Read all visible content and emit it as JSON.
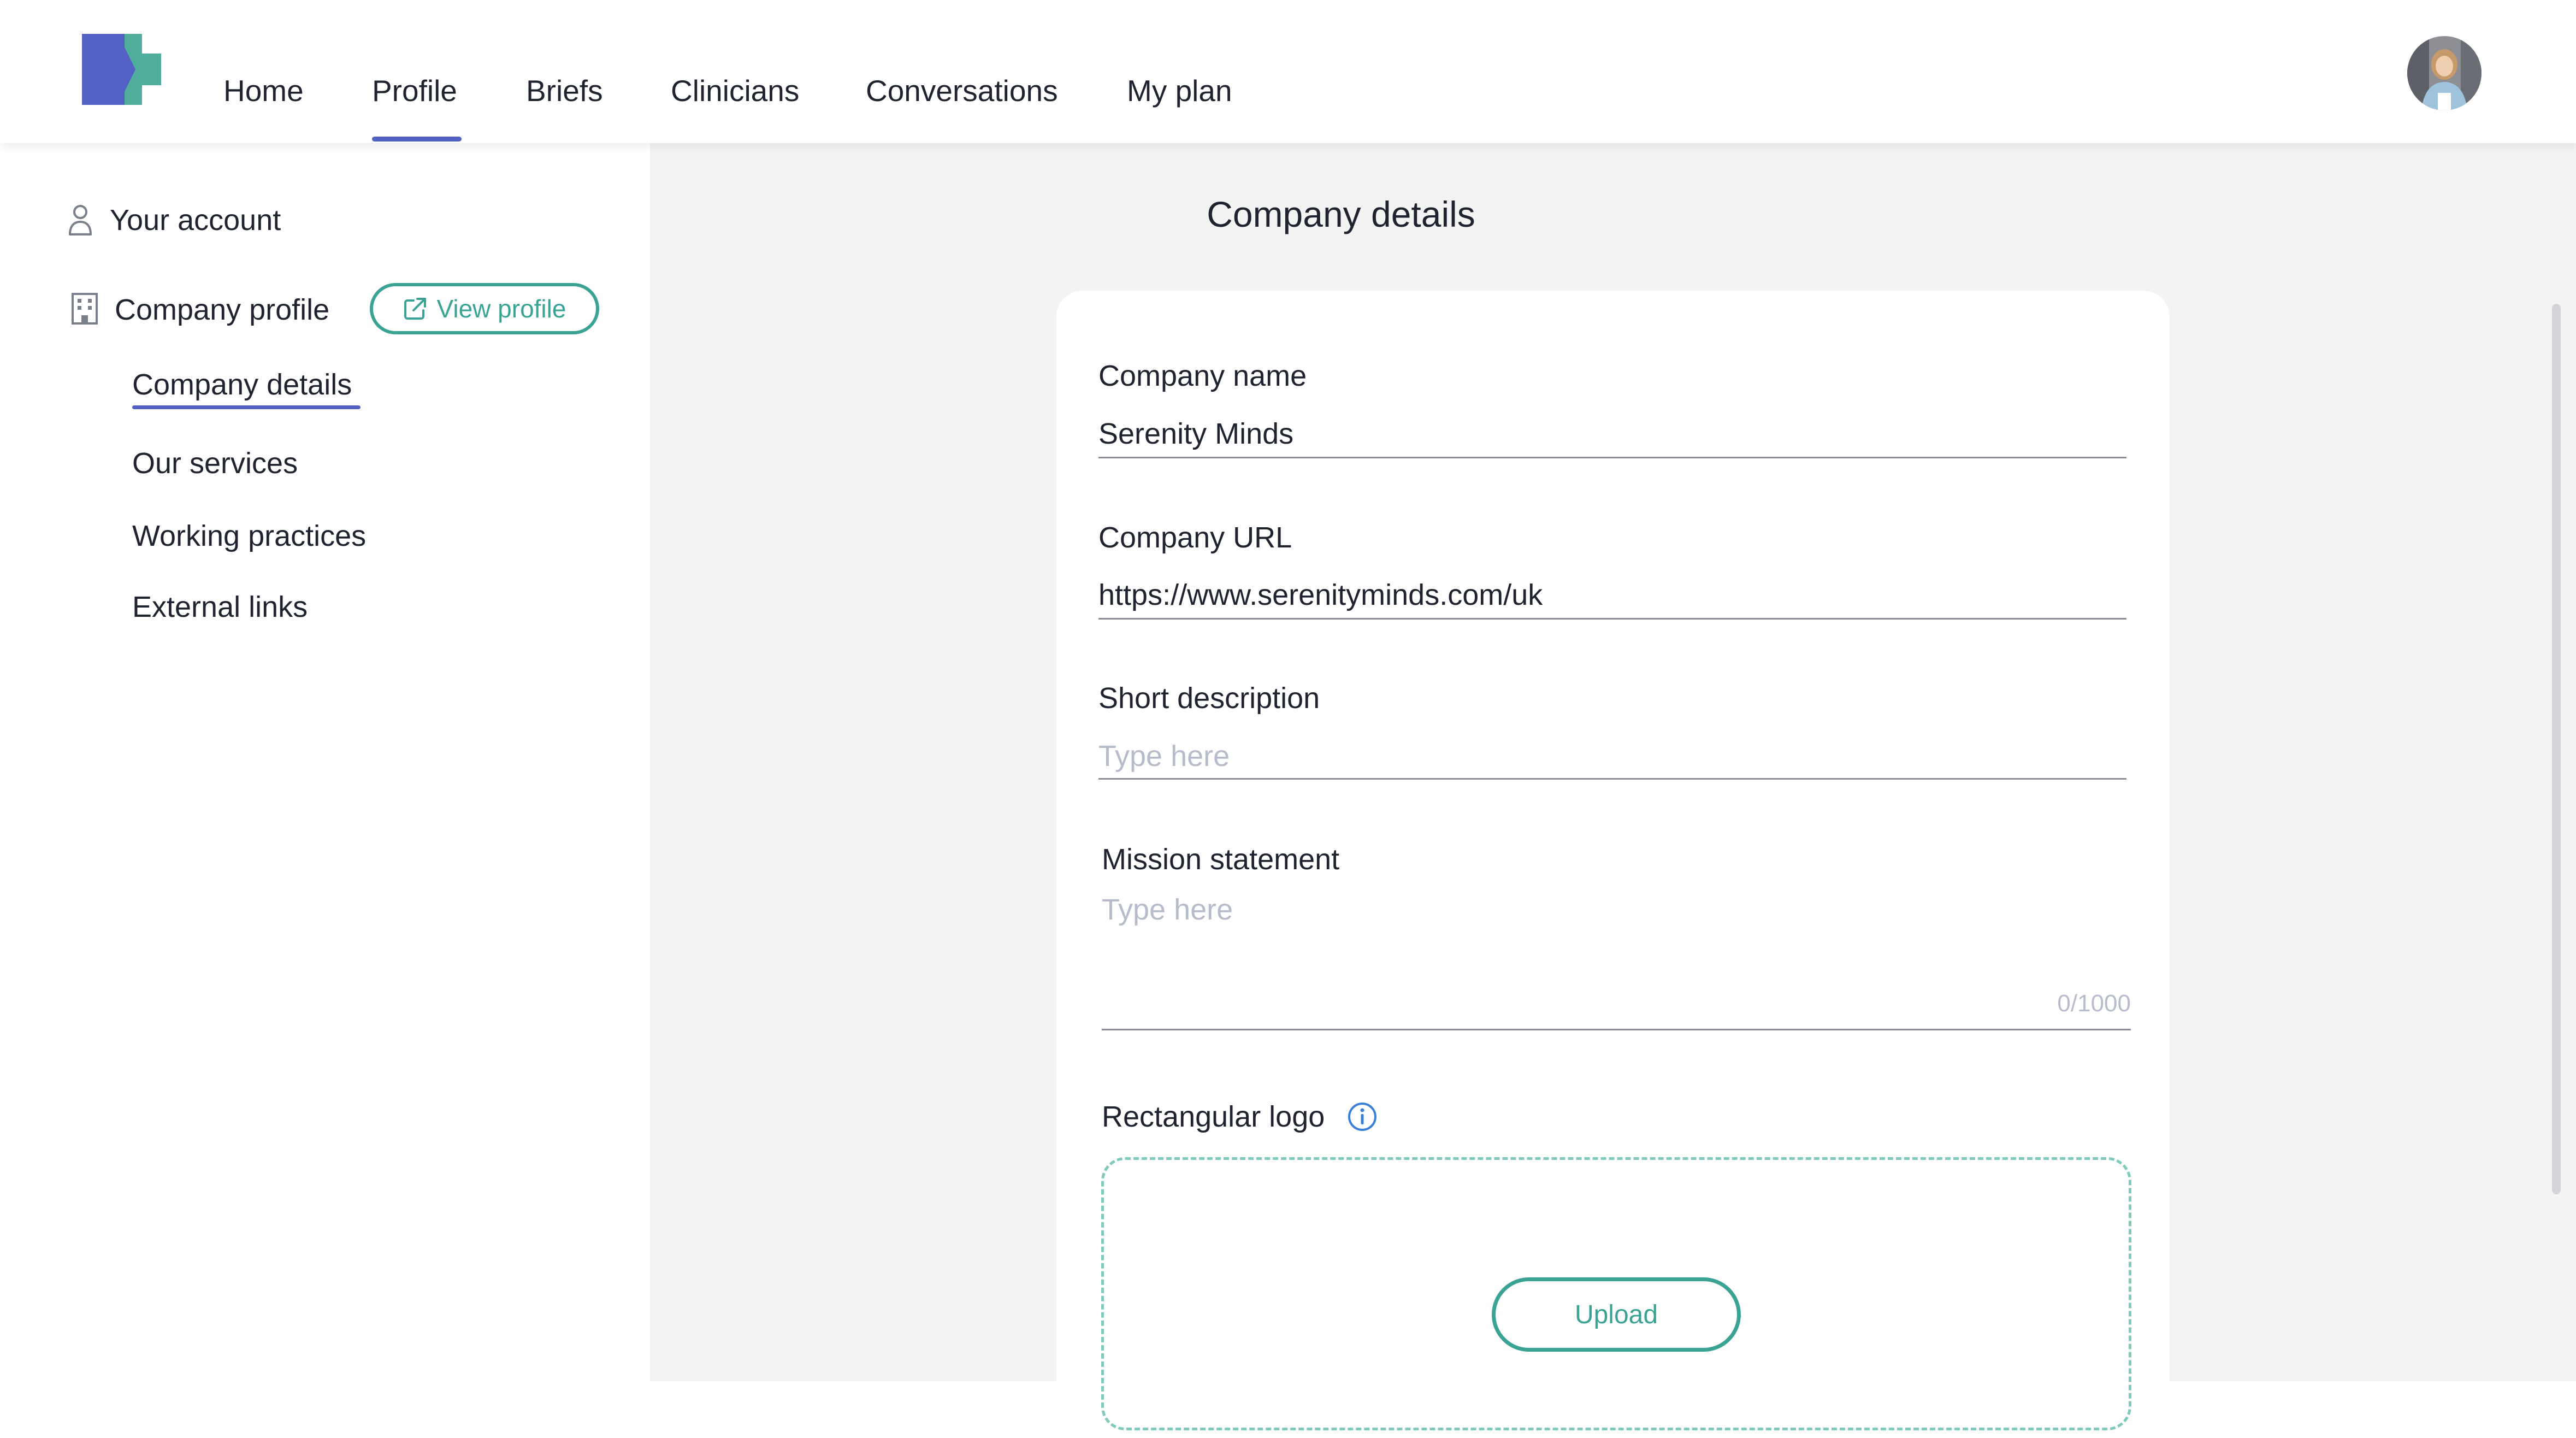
{
  "nav": {
    "items": [
      "Home",
      "Profile",
      "Briefs",
      "Clinicians",
      "Conversations",
      "My plan"
    ],
    "active": "Profile"
  },
  "sidebar": {
    "account_label": "Your account",
    "company_profile_label": "Company profile",
    "view_profile_label": "View profile",
    "sub_items": [
      "Company details",
      "Our services",
      "Working practices",
      "External links"
    ],
    "active_sub_item": "Company details"
  },
  "main": {
    "title": "Company details",
    "company_name": {
      "label": "Company name",
      "value": "Serenity Minds"
    },
    "company_url": {
      "label": "Company URL",
      "value": "https://www.serenityminds.com/uk"
    },
    "short_description": {
      "label": "Short description",
      "placeholder": "Type here"
    },
    "mission_statement": {
      "label": "Mission statement",
      "placeholder": "Type here",
      "counter": "0/1000"
    },
    "rectangular_logo": {
      "label": "Rectangular logo",
      "upload_label": "Upload"
    }
  },
  "colors": {
    "brand_blue": "#5361c4",
    "brand_teal": "#3aa394",
    "background": "#f3f3f4",
    "info_blue": "#3b7fd9"
  },
  "icons": [
    "logo-mark",
    "user-icon",
    "building-icon",
    "external-link-icon",
    "info-icon",
    "avatar"
  ]
}
